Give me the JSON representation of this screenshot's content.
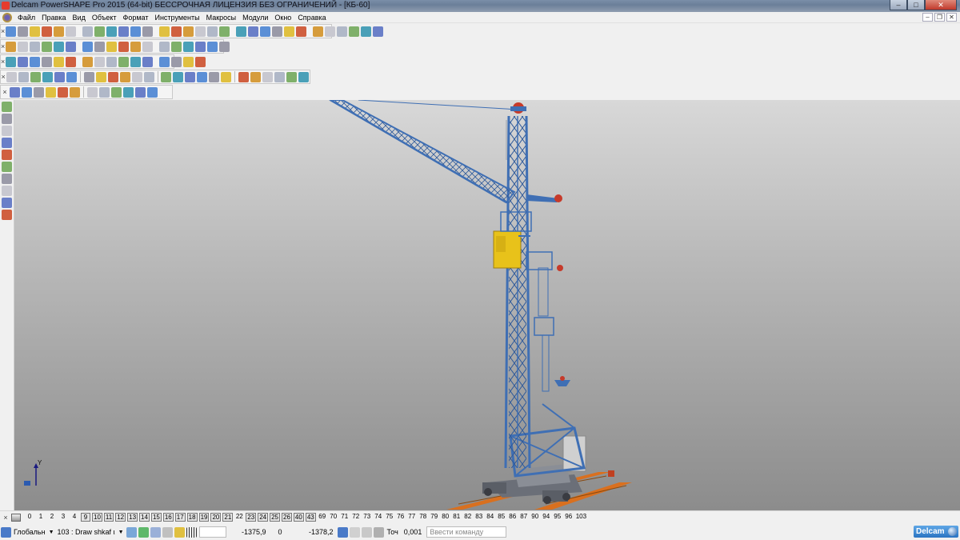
{
  "window": {
    "title": "Delcam PowerSHAPE Pro 2015 (64-bit) БЕССРОЧНАЯ ЛИЦЕНЗИЯ БЕЗ ОГРАНИЧЕНИЙ - [КБ-60]",
    "controls": {
      "minimize": "–",
      "maximize": "□",
      "close": "✕"
    },
    "mdi_controls": {
      "minimize": "–",
      "restore": "❐",
      "close": "✕"
    }
  },
  "menu": [
    "Файл",
    "Правка",
    "Вид",
    "Объект",
    "Формат",
    "Инструменты",
    "Макросы",
    "Модули",
    "Окно",
    "Справка"
  ],
  "toolbars": {
    "row1_icons": 30,
    "row2_icons": 18,
    "row3_icons": 16,
    "row4_icons": 24,
    "row5_icons": 12,
    "close_glyph": "×"
  },
  "viewport": {
    "axis_label": "Y",
    "background_top": "#d8d8d8",
    "background_bottom": "#8c8c8c",
    "crane_blue": "#3f6fb4",
    "cabin_yellow": "#e8c21a",
    "rail_orange": "#d9701f"
  },
  "levels": [
    "0",
    "1",
    "2",
    "3",
    "4",
    "9",
    "10",
    "11",
    "12",
    "13",
    "14",
    "15",
    "16",
    "17",
    "18",
    "19",
    "20",
    "21",
    "22",
    "23",
    "24",
    "25",
    "26",
    "40",
    "43",
    "69",
    "70",
    "71",
    "72",
    "73",
    "74",
    "75",
    "76",
    "77",
    "78",
    "79",
    "80",
    "81",
    "82",
    "83",
    "84",
    "85",
    "86",
    "87",
    "90",
    "94",
    "95",
    "96",
    "103"
  ],
  "levels_active": [
    "9",
    "10",
    "11",
    "12",
    "13",
    "14",
    "15",
    "16",
    "17",
    "18",
    "19",
    "20",
    "21",
    "23",
    "24",
    "25",
    "26",
    "40",
    "43"
  ],
  "status": {
    "workplane": "Глобальн",
    "drawing": "103 : Draw shkaf ι",
    "coord_x": "-1375,9",
    "coord_y": "0",
    "coord_z": "-1378,2",
    "tolerance_label": "Точ",
    "tolerance": "0,001",
    "command_placeholder": "Ввести команду",
    "brand": "Delcam"
  }
}
